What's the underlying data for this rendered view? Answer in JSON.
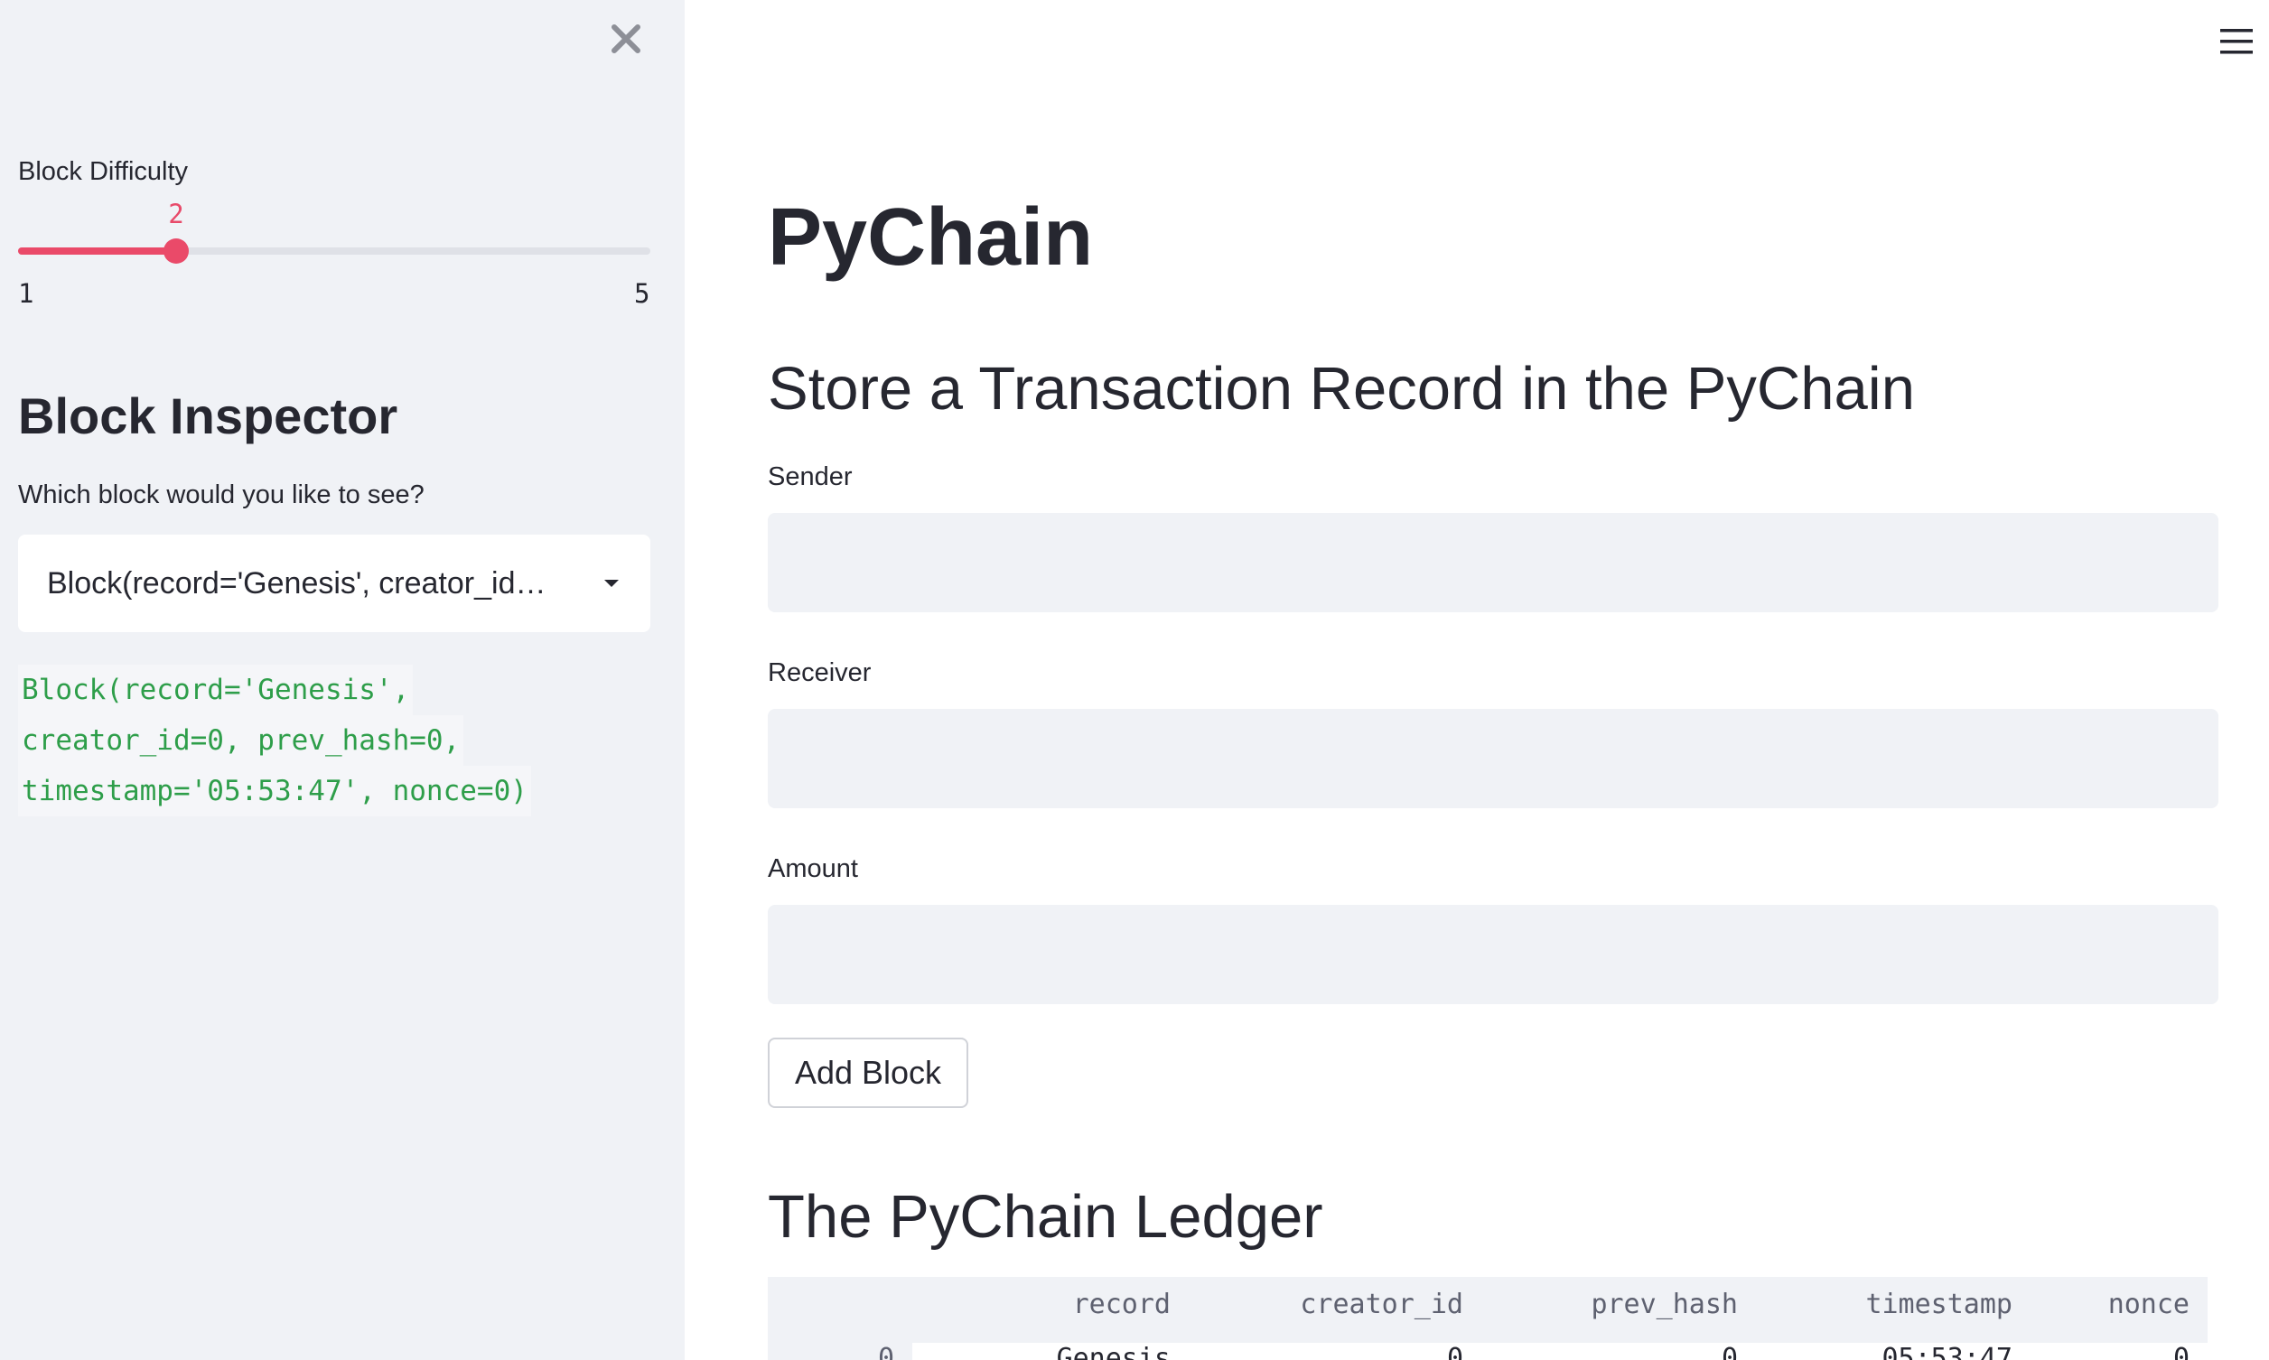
{
  "sidebar": {
    "slider": {
      "label": "Block Difficulty",
      "value": "2",
      "min": "1",
      "max": "5",
      "fill_fraction": 0.25,
      "accent_color": "#ea4a69"
    },
    "inspector": {
      "heading": "Block Inspector",
      "select_label": "Which block would you like to see?",
      "select_value": "Block(record='Genesis', creator_id…",
      "code_lines": [
        "Block(record='Genesis',",
        "creator_id=0, prev_hash=0,",
        "timestamp='05:53:47', nonce=0)"
      ]
    },
    "icons": {
      "close": "close-icon",
      "dropdown": "chevron-down-icon"
    }
  },
  "main": {
    "menu_icon": "hamburger-menu-icon",
    "title": "PyChain",
    "store_heading": "Store a Transaction Record in the PyChain",
    "fields": {
      "sender_label": "Sender",
      "sender_value": "",
      "receiver_label": "Receiver",
      "receiver_value": "",
      "amount_label": "Amount",
      "amount_value": ""
    },
    "add_button": "Add Block",
    "ledger_heading": "The PyChain Ledger",
    "ledger": {
      "columns": [
        "",
        "record",
        "creator_id",
        "prev_hash",
        "timestamp",
        "nonce"
      ],
      "rows": [
        [
          "0",
          "Genesis",
          "0",
          "0",
          "05:53:47",
          "0"
        ]
      ]
    }
  }
}
